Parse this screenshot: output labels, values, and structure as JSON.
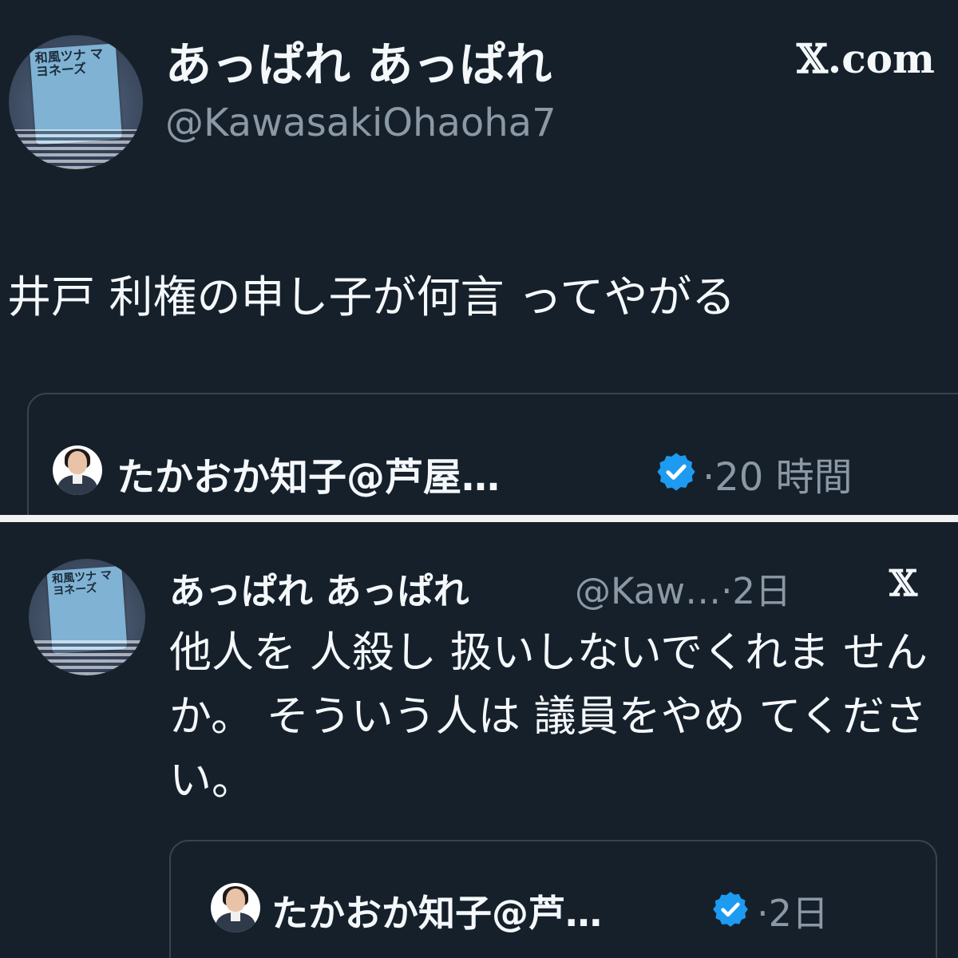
{
  "top_post": {
    "author_name": "あっぱれ あっぱれ",
    "author_handle": "@KawasakiOhaoha7",
    "site_logo": "𝕏.com",
    "body": "井戸 利権の申し子が何言 ってやがる",
    "avatar_label": "和風ツナ マヨネーズ",
    "quoted": {
      "author_name": "たかおか知子@芦屋…",
      "verified_icon": "verified-badge-icon",
      "time": "·20 時間"
    }
  },
  "bottom_post": {
    "author_name": "あっぱれ あっぱれ",
    "author_handle_time": "@Kaw…·2日",
    "site_logo": "𝕏",
    "body": "他人を 人殺し 扱いしないでくれま せんか。 そういう人は 議員をやめ てください。",
    "avatar_label": "和風ツナ マヨネーズ",
    "quoted": {
      "author_name": "たかおか知子@芦…",
      "verified_icon": "verified-badge-icon",
      "time": "·2日"
    }
  },
  "colors": {
    "background": "#15202b",
    "text_primary": "#f5f8fa",
    "text_secondary": "#8b98a5",
    "border": "#38444d",
    "verified_blue": "#1d9bf0",
    "divider": "#f2f2f2"
  }
}
